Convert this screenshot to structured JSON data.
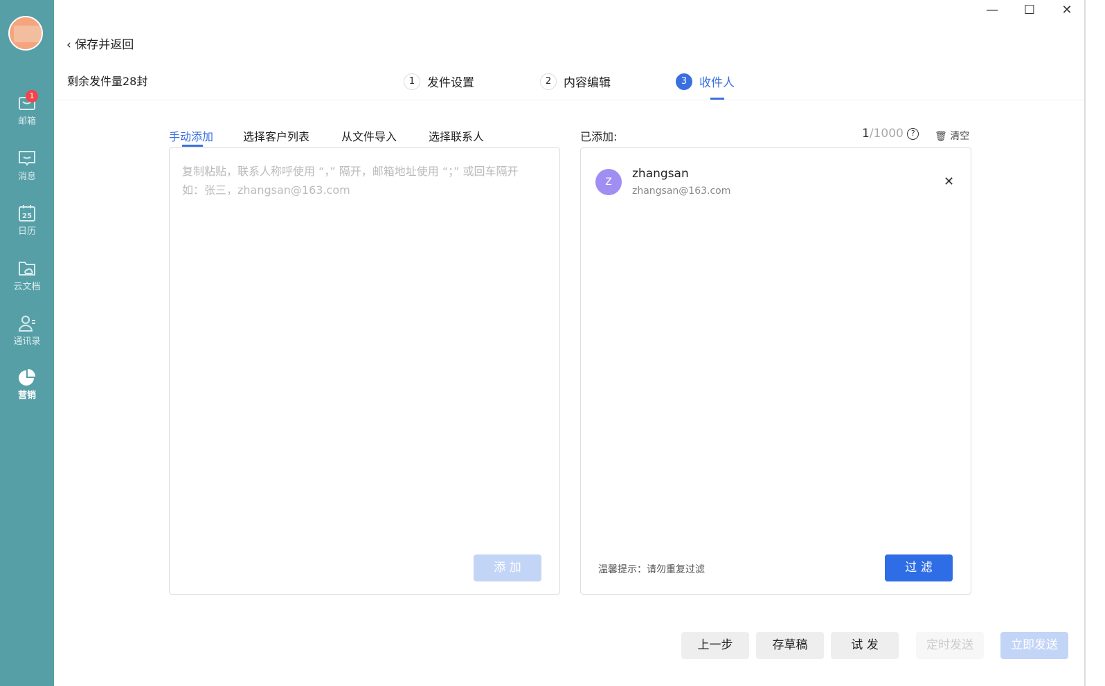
{
  "sidebar": {
    "items": [
      {
        "label": "邮箱",
        "badge": "1"
      },
      {
        "label": "消息"
      },
      {
        "label": "日历",
        "day": "25"
      },
      {
        "label": "云文档"
      },
      {
        "label": "通讯录"
      },
      {
        "label": "营销"
      }
    ]
  },
  "window": {
    "minimize": "—",
    "maximize": "☐",
    "close": "✕"
  },
  "header": {
    "back": "保存并返回",
    "quota": "剩余发件量28封"
  },
  "steps": [
    {
      "n": "1",
      "label": "发件设置"
    },
    {
      "n": "2",
      "label": "内容编辑"
    },
    {
      "n": "3",
      "label": "收件人"
    }
  ],
  "tabs": [
    "手动添加",
    "选择客户列表",
    "从文件导入",
    "选择联系人"
  ],
  "manual": {
    "placeholder1": "复制粘贴，联系人称呼使用 “，” 隔开，邮箱地址使用 “；” 或回车隔开",
    "placeholder2": "如：张三，zhangsan@163.com",
    "add": "添 加"
  },
  "added": {
    "label": "已添加:",
    "count": "1",
    "max": "/1000",
    "clear": "清空",
    "tip": "温馨提示：请勿重复过滤",
    "filter": "过 滤",
    "items": [
      {
        "initial": "Z",
        "name": "zhangsan",
        "email": "zhangsan@163.com"
      }
    ]
  },
  "footer": {
    "prev": "上一步",
    "draft": "存草稿",
    "test": "试 发",
    "schedule": "定时发送",
    "send": "立即发送"
  },
  "colors": {
    "sidebar": "#579fa6",
    "accent": "#3a6fe0"
  }
}
